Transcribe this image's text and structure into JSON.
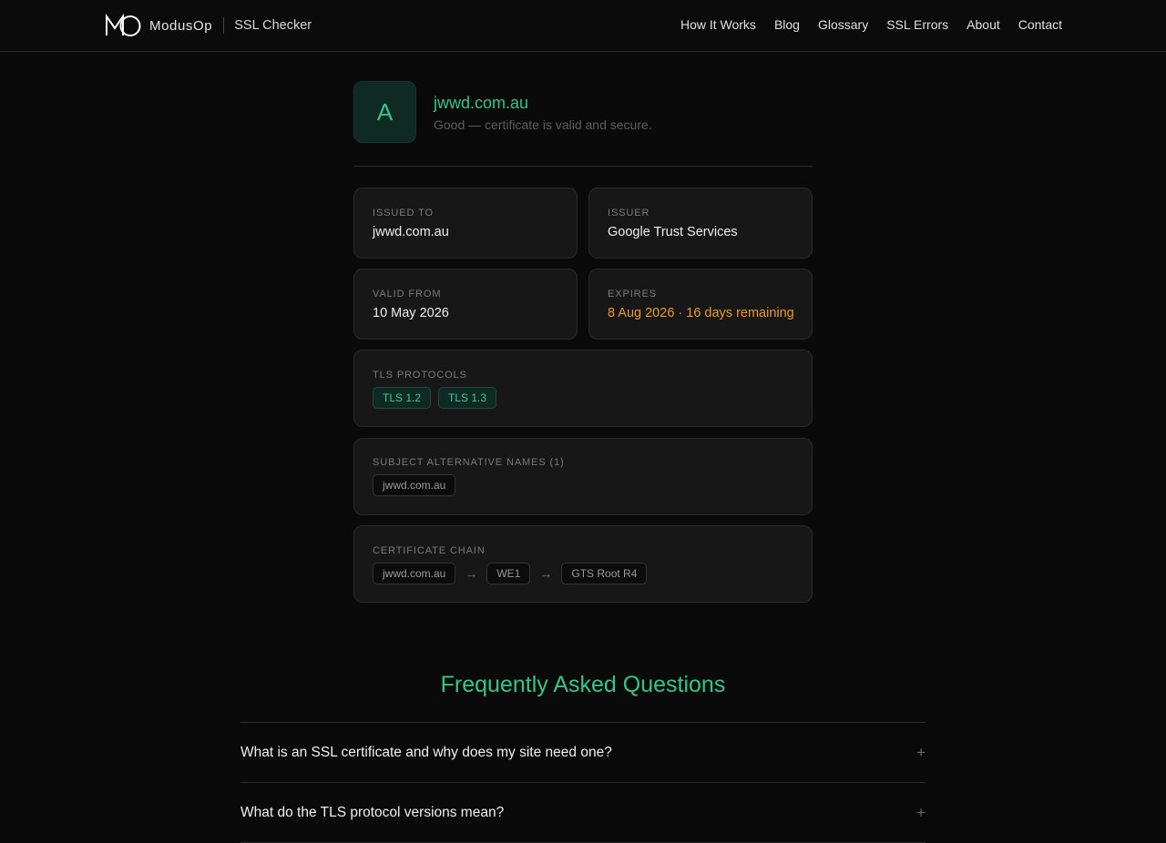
{
  "header": {
    "brand_name": "ModusOp",
    "product_name": "SSL Checker",
    "nav": [
      "How It Works",
      "Blog",
      "Glossary",
      "SSL Errors",
      "About",
      "Contact"
    ]
  },
  "result": {
    "grade": "A",
    "domain": "jwwd.com.au",
    "verdict": "Good — certificate is valid and secure."
  },
  "details": {
    "issued_to": {
      "label": "ISSUED TO",
      "value": "jwwd.com.au"
    },
    "issuer": {
      "label": "ISSUER",
      "value": "Google Trust Services"
    },
    "valid_from": {
      "label": "VALID FROM",
      "value": "10 May 2026"
    },
    "expires": {
      "label": "EXPIRES",
      "value": "8 Aug 2026 · 16 days remaining"
    }
  },
  "tls": {
    "label": "TLS PROTOCOLS",
    "protocols": [
      "TLS 1.2",
      "TLS 1.3"
    ]
  },
  "san": {
    "label": "SUBJECT ALTERNATIVE NAMES (1)",
    "names": [
      "jwwd.com.au"
    ]
  },
  "chain": {
    "label": "CERTIFICATE CHAIN",
    "items": [
      "jwwd.com.au",
      "WE1",
      "GTS Root R4"
    ]
  },
  "faq": {
    "title": "Frequently Asked Questions",
    "questions": [
      "What is an SSL certificate and why does my site need one?",
      "What do the TLS protocol versions mean?"
    ]
  },
  "colors": {
    "accent_green": "#34c58f",
    "warning_orange": "#e89a2c",
    "background": "#0a0a0a"
  }
}
